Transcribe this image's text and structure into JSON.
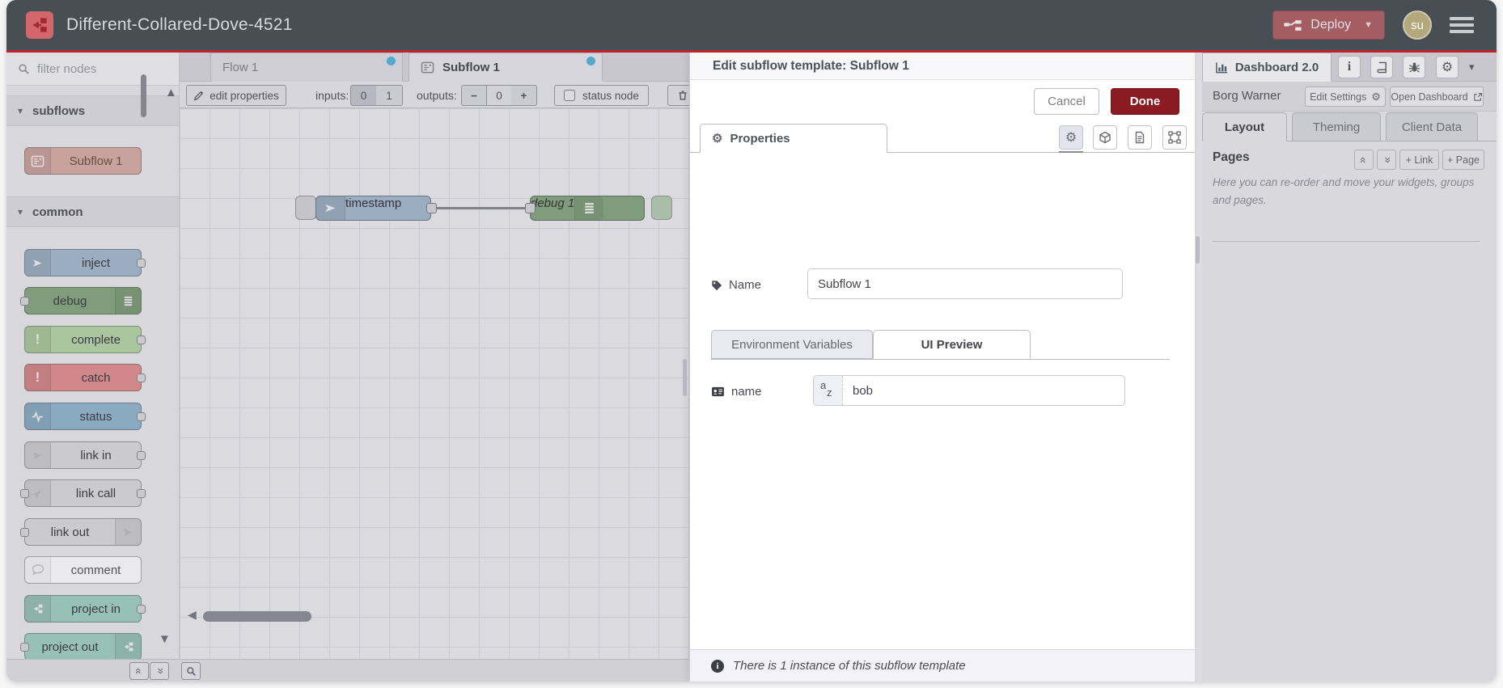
{
  "header": {
    "title": "Different-Collared-Dove-4521",
    "deploy_label": "Deploy",
    "avatar_initials": "su"
  },
  "palette": {
    "search_placeholder": "filter nodes",
    "categories": [
      {
        "label": "subflows",
        "items": [
          {
            "label": "Subflow 1",
            "color": "#d9afa7",
            "icon": "subflow-icon"
          }
        ]
      },
      {
        "label": "common",
        "items": [
          {
            "label": "inject",
            "color": "#a6bbcf",
            "icon": "inject-arrow-icon"
          },
          {
            "label": "debug",
            "color": "#87a980",
            "icon": "debug-list-icon"
          },
          {
            "label": "complete",
            "color": "#b8d7a8",
            "icon": "exclamation-icon"
          },
          {
            "label": "catch",
            "color": "#e49191",
            "icon": "exclamation-icon"
          },
          {
            "label": "status",
            "color": "#94b8cf",
            "icon": "pulse-icon"
          },
          {
            "label": "link in",
            "color": "#dddddd",
            "icon": "link-arrow-icon"
          },
          {
            "label": "link call",
            "color": "#dddddd",
            "icon": "link-arrow-icon"
          },
          {
            "label": "link out",
            "color": "#dddddd",
            "icon": "link-arrow-icon"
          },
          {
            "label": "comment",
            "color": "#ffffff",
            "icon": "comment-bubble-icon"
          },
          {
            "label": "project in",
            "color": "#a3d1c2",
            "icon": "project-icon"
          },
          {
            "label": "project out",
            "color": "#a3d1c2",
            "icon": "project-icon"
          }
        ]
      }
    ]
  },
  "workspace": {
    "tabs": [
      {
        "label": "Flow 1",
        "state": "inactive",
        "modified_dot": true
      },
      {
        "label": "Subflow 1",
        "state": "active",
        "modified_dot": true
      }
    ],
    "toolbar": {
      "edit_properties": "edit properties",
      "inputs_label": "inputs:",
      "input_zero": "0",
      "input_one": "1",
      "selected_inputs": "0",
      "outputs_label": "outputs:",
      "minus": "−",
      "output_value": "0",
      "plus": "+",
      "status_node_label": "status node"
    },
    "canvas": {
      "nodes": [
        {
          "label": "timestamp",
          "type": "inject",
          "color": "#a6bbcf"
        },
        {
          "label": "debug 1",
          "type": "debug",
          "color": "#87a980"
        }
      ]
    }
  },
  "tray": {
    "title": "Edit subflow template: Subflow 1",
    "cancel_label": "Cancel",
    "done_label": "Done",
    "properties_tab": "Properties",
    "tab_icons": [
      "gear-icon",
      "cube-icon",
      "description-icon",
      "appearance-icon"
    ],
    "name_label": "Name",
    "name_value": "Subflow 1",
    "subtabs": [
      "Environment Variables",
      "UI Preview"
    ],
    "active_subtab": "UI Preview",
    "ui_preview": {
      "field_label": "name",
      "field_type": "az",
      "field_value": "bob"
    },
    "footer_text": "There is 1 instance of this subflow template"
  },
  "sidebar": {
    "tab_label": "Dashboard 2.0",
    "icon_buttons": [
      "info-icon",
      "book-icon",
      "bug-icon",
      "gear-icon"
    ],
    "project_name": "Borg Warner",
    "edit_settings_label": "Edit Settings",
    "open_dashboard_label": "Open Dashboard",
    "tabs": [
      "Layout",
      "Theming",
      "Client Data"
    ],
    "active_tab": "Layout",
    "pages_heading": "Pages",
    "link_button": "+ Link",
    "page_button": "+ Page",
    "help_text": "Here you can re-order and move your widgets, groups and pages."
  },
  "colors": {
    "header_bg": "#474e54",
    "accent_red_line": "#c2242b",
    "deploy_bg": "#a35d63",
    "done_bg": "#8c1a22",
    "modified_dot": "#58b8dc",
    "avatar_bg": "#b4a87c"
  }
}
